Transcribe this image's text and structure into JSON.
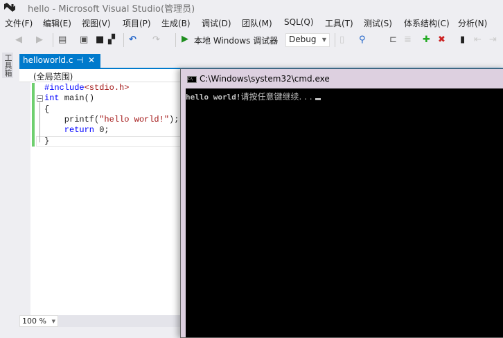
{
  "window": {
    "title": "hello - Microsoft Visual Studio(管理员)"
  },
  "menu": [
    "文件(F)",
    "编辑(E)",
    "视图(V)",
    "项目(P)",
    "生成(B)",
    "调试(D)",
    "团队(M)",
    "SQL(Q)",
    "工具(T)",
    "测试(S)",
    "体系结构(C)",
    "分析(N)"
  ],
  "toolbar": {
    "run_label": "本地 Windows 调试器",
    "config": "Debug"
  },
  "toolbox": {
    "label": "工具箱"
  },
  "tab": {
    "label": "helloworld.c",
    "pin": "⊣",
    "close": "✕"
  },
  "scope": "(全局范围)",
  "code": {
    "l1_kw": "#include",
    "l1_inc": "<stdio.h>",
    "l2_kw": "int",
    "l2_rest": " main()",
    "l3": "{",
    "l4_a": "    printf(",
    "l4_str": "\"hello world!\"",
    "l4_b": ");",
    "l5_kw": "    return",
    "l5_rest": " 0;",
    "l6": "}"
  },
  "zoom": "100 %",
  "cmd": {
    "title": "C:\\Windows\\system32\\cmd.exe",
    "output_en": "hello world!",
    "output_cn": "请按任意键继续. . ."
  }
}
